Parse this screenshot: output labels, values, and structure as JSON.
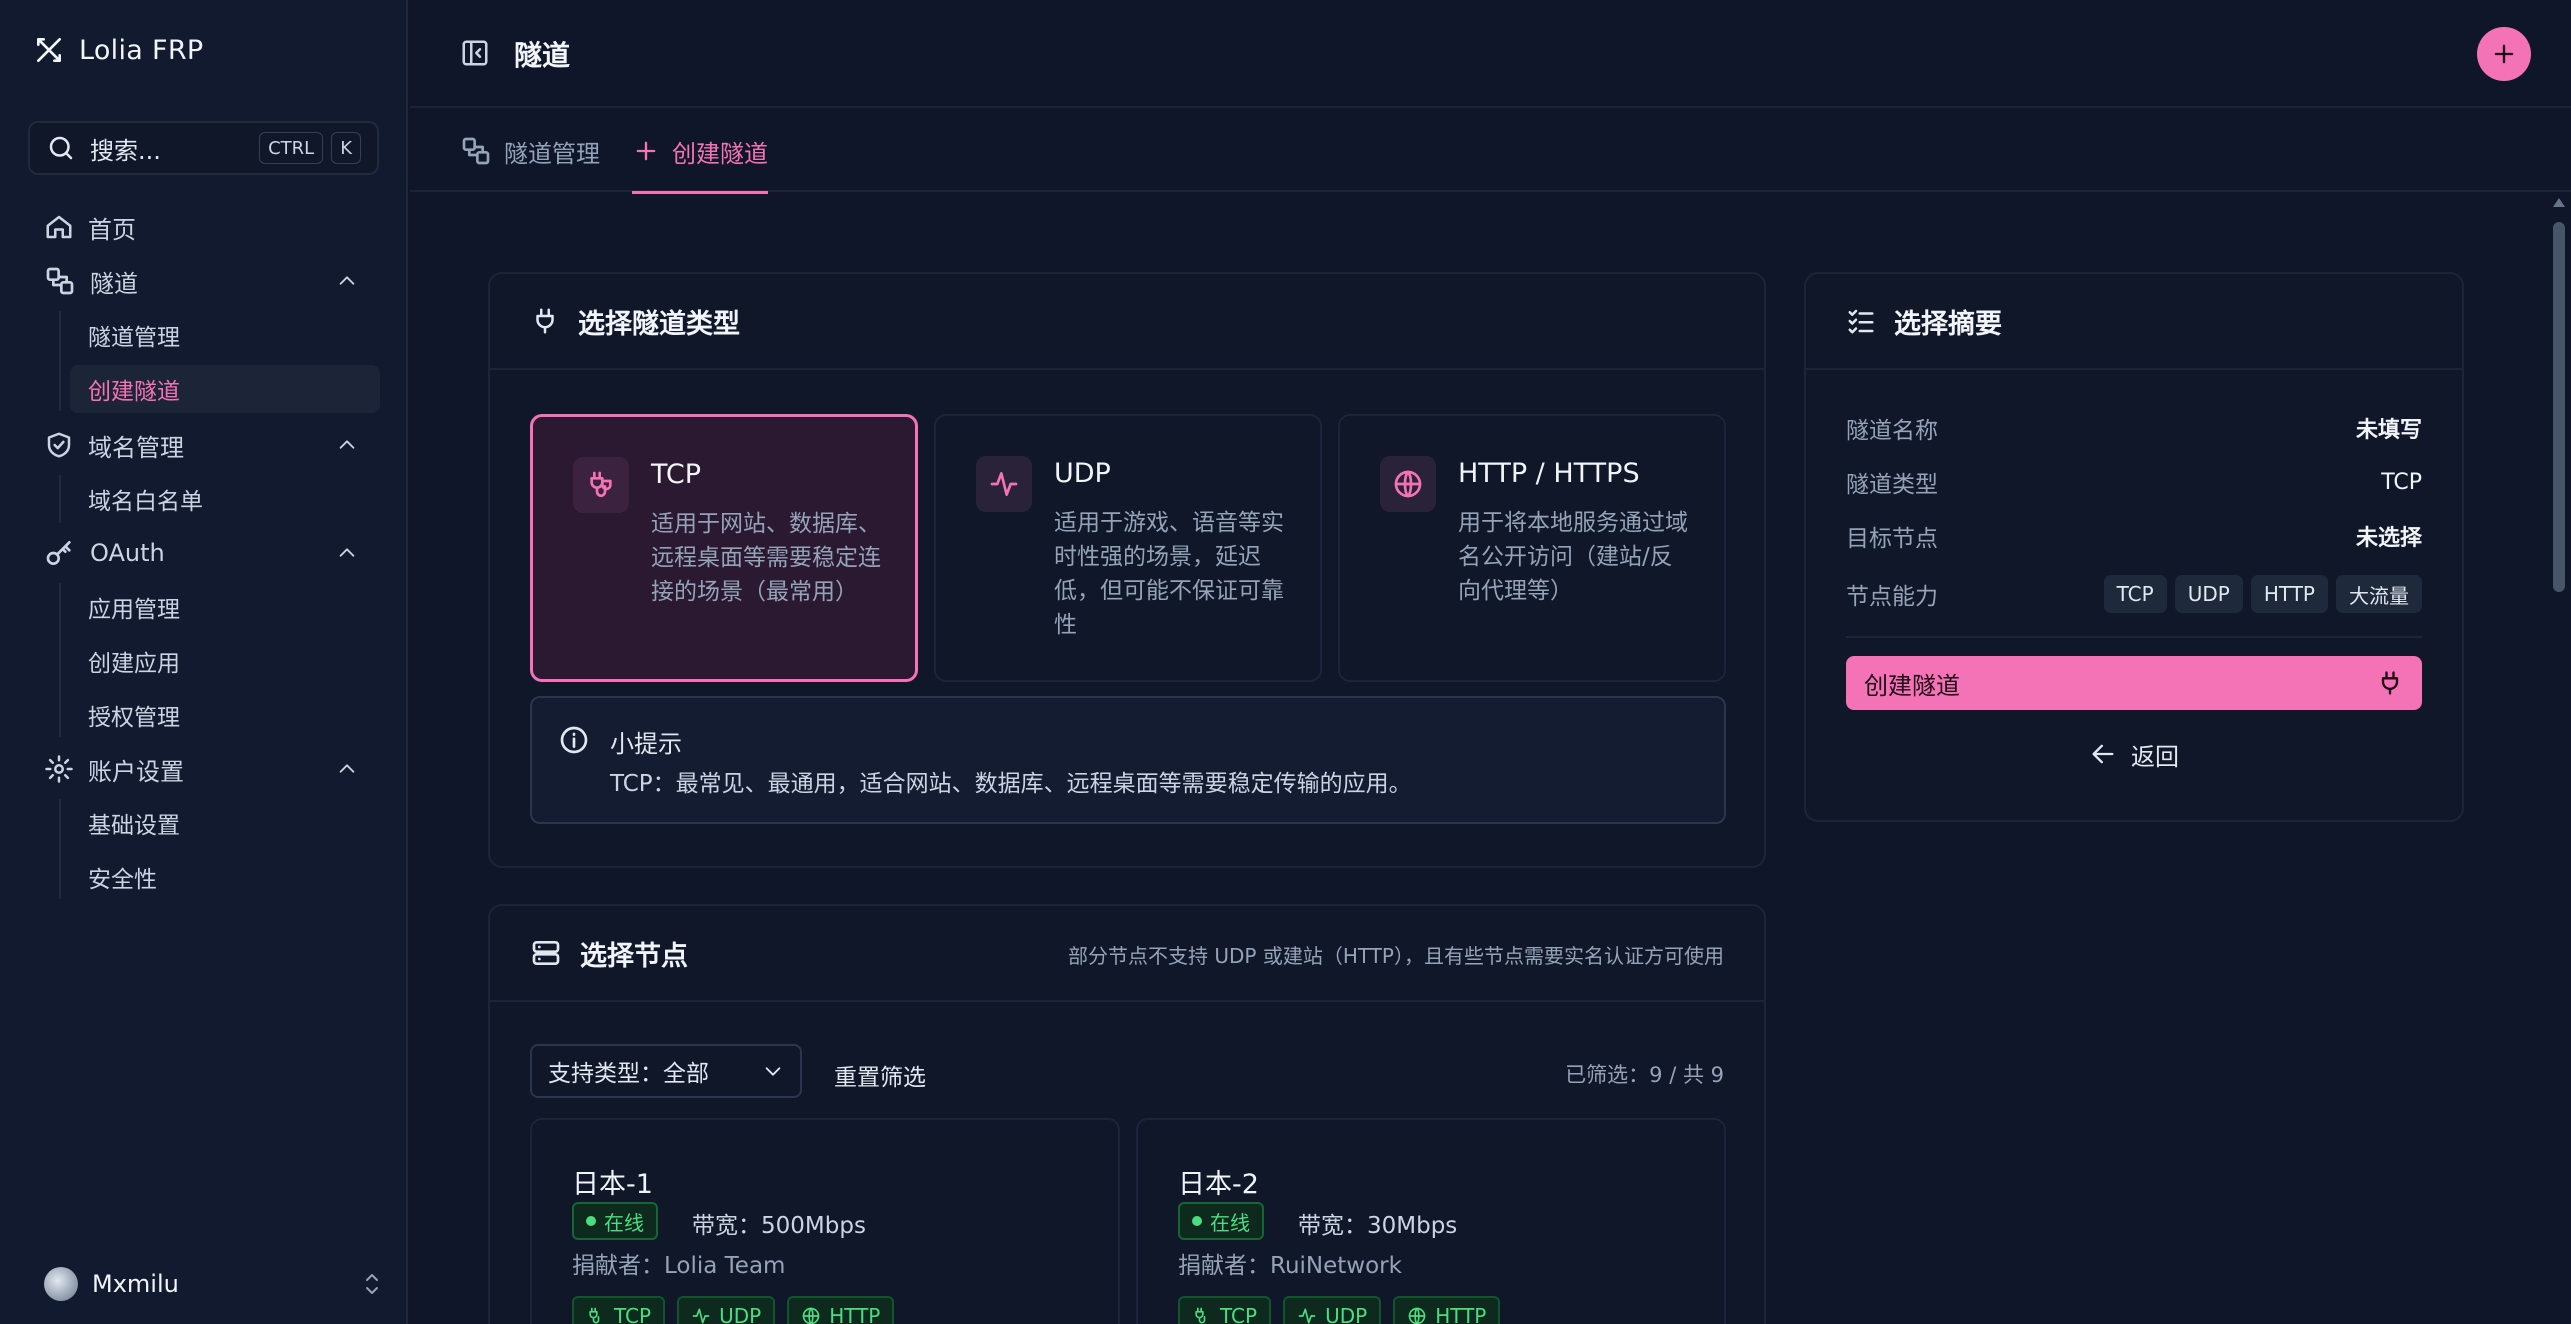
{
  "app": {
    "name": "Lolia FRP"
  },
  "search": {
    "placeholder": "搜索...",
    "kbd1": "CTRL",
    "kbd2": "K"
  },
  "sidebar": {
    "home": "首页",
    "tunnel": {
      "label": "隧道",
      "items": [
        "隧道管理",
        "创建隧道"
      ]
    },
    "domain": {
      "label": "域名管理",
      "items": [
        "域名白名单"
      ]
    },
    "oauth": {
      "label": "OAuth",
      "items": [
        "应用管理",
        "创建应用",
        "授权管理"
      ]
    },
    "account": {
      "label": "账户设置",
      "items": [
        "基础设置",
        "安全性"
      ]
    }
  },
  "user": {
    "name": "Mxmilu"
  },
  "header": {
    "title": "隧道"
  },
  "tabs": [
    {
      "label": "隧道管理"
    },
    {
      "label": "创建隧道"
    }
  ],
  "type_section": {
    "title": "选择隧道类型",
    "types": [
      {
        "name": "TCP",
        "desc": "适用于网站、数据库、远程桌面等需要稳定连接的场景（最常用）"
      },
      {
        "name": "UDP",
        "desc": "适用于游戏、语音等实时性强的场景，延迟低，但可能不保证可靠性"
      },
      {
        "name": "HTTP / HTTPS",
        "desc": "用于将本地服务通过域名公开访问（建站/反向代理等）"
      }
    ],
    "tip_title": "小提示",
    "tip_text": "TCP：最常见、最通用，适合网站、数据库、远程桌面等需要稳定传输的应用。"
  },
  "summary": {
    "title": "选择摘要",
    "rows": [
      {
        "key": "隧道名称",
        "value": "未填写"
      },
      {
        "key": "隧道类型",
        "value": "TCP"
      },
      {
        "key": "目标节点",
        "value": "未选择"
      }
    ],
    "cap_label": "节点能力",
    "caps": [
      "TCP",
      "UDP",
      "HTTP",
      "大流量"
    ],
    "create": "创建隧道",
    "back": "返回"
  },
  "node_section": {
    "title": "选择节点",
    "note": "部分节点不支持 UDP 或建站（HTTP），且有些节点需要实名认证方可使用",
    "filter": "支持类型：全部",
    "reset": "重置筛选",
    "count": "已筛选：9 / 共 9",
    "nodes": [
      {
        "name": "日本-1",
        "status": "在线",
        "bandwidth": "带宽：500Mbps",
        "donor": "捐献者：Lolia Team",
        "features": [
          "TCP",
          "UDP",
          "HTTP"
        ]
      },
      {
        "name": "日本-2",
        "status": "在线",
        "bandwidth": "带宽：30Mbps",
        "donor": "捐献者：RuiNetwork",
        "features": [
          "TCP",
          "UDP",
          "HTTP"
        ]
      }
    ]
  },
  "colors": {
    "accent": "#f472b6",
    "online": "#4ade80",
    "bg": "#0f1629"
  }
}
